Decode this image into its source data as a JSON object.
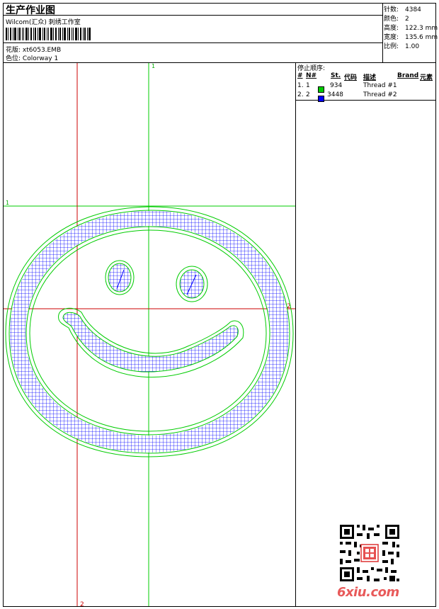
{
  "header": {
    "title": "生产作业图",
    "company": "Wilcom(汇众) 刺绣工作室",
    "design_label": "花版:",
    "design_value": "xt6053.EMB",
    "colorway_label": "色位:",
    "colorway_value": "Colorway 1"
  },
  "stats": [
    {
      "label": "针数:",
      "value": "4384"
    },
    {
      "label": "颜色:",
      "value": "2"
    },
    {
      "label": "高度:",
      "value": "122.3 mm"
    },
    {
      "label": "宽度:",
      "value": "135.6 mm"
    },
    {
      "label": "比例:",
      "value": "1.00"
    }
  ],
  "thread_table": {
    "title": "停止顺序:",
    "headers": {
      "num": "#",
      "n": "N#",
      "st": "St.",
      "code": "代码",
      "desc": "描述",
      "brand": "Brand",
      "element": "元素"
    },
    "rows": [
      {
        "seq": "1.",
        "n": "1",
        "code": "934",
        "desc": "Thread #1",
        "color": "#00cc00"
      },
      {
        "seq": "2.",
        "n": "2",
        "code": "3448",
        "desc": "Thread #2",
        "color": "#0000ff"
      }
    ]
  },
  "design_area": {
    "guide_labels": {
      "top_green": "1",
      "left_green": "1",
      "right_red": "2",
      "bottom_red": "2"
    },
    "colors": {
      "green_guide": "#00cc00",
      "red_guide": "#cc0000",
      "fill": "#0000ff",
      "outline": "#00cc00"
    }
  },
  "watermark": {
    "text": "6xiu.com"
  }
}
